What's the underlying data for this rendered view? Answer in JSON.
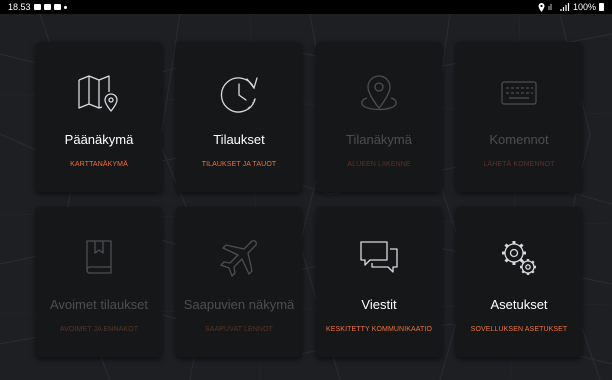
{
  "status_bar": {
    "time": "18.53",
    "battery": "100%"
  },
  "colors": {
    "accent": "#f0713a",
    "accent_disabled": "#5a3325",
    "tile_bg": "#161719",
    "background": "#1c1e22"
  },
  "tiles": [
    {
      "title": "Päänäkymä",
      "subtitle": "KARTTANÄKYMÄ",
      "icon": "map-pin-icon",
      "enabled": true
    },
    {
      "title": "Tilaukset",
      "subtitle": "TILAUKSET JA TAUOT",
      "icon": "clock-refresh-icon",
      "enabled": true
    },
    {
      "title": "Tilanäkymä",
      "subtitle": "ALUEEN LIIKENNE",
      "icon": "location-pin-icon",
      "enabled": false
    },
    {
      "title": "Komennot",
      "subtitle": "LÄHETÄ KOMENNOT",
      "icon": "keyboard-icon",
      "enabled": false
    },
    {
      "title": "Avoimet tilaukset",
      "subtitle": "AVOIMET JA ENNAKOT",
      "icon": "book-icon",
      "enabled": false
    },
    {
      "title": "Saapuvien näkymä",
      "subtitle": "SAAPUVAT LENNOT",
      "icon": "airplane-icon",
      "enabled": false
    },
    {
      "title": "Viestit",
      "subtitle": "KESKITETTY KOMMUNIKAATIO",
      "icon": "chat-bubbles-icon",
      "enabled": true
    },
    {
      "title": "Asetukset",
      "subtitle": "SOVELLUKSEN ASETUKSET",
      "icon": "gears-icon",
      "enabled": true
    }
  ]
}
